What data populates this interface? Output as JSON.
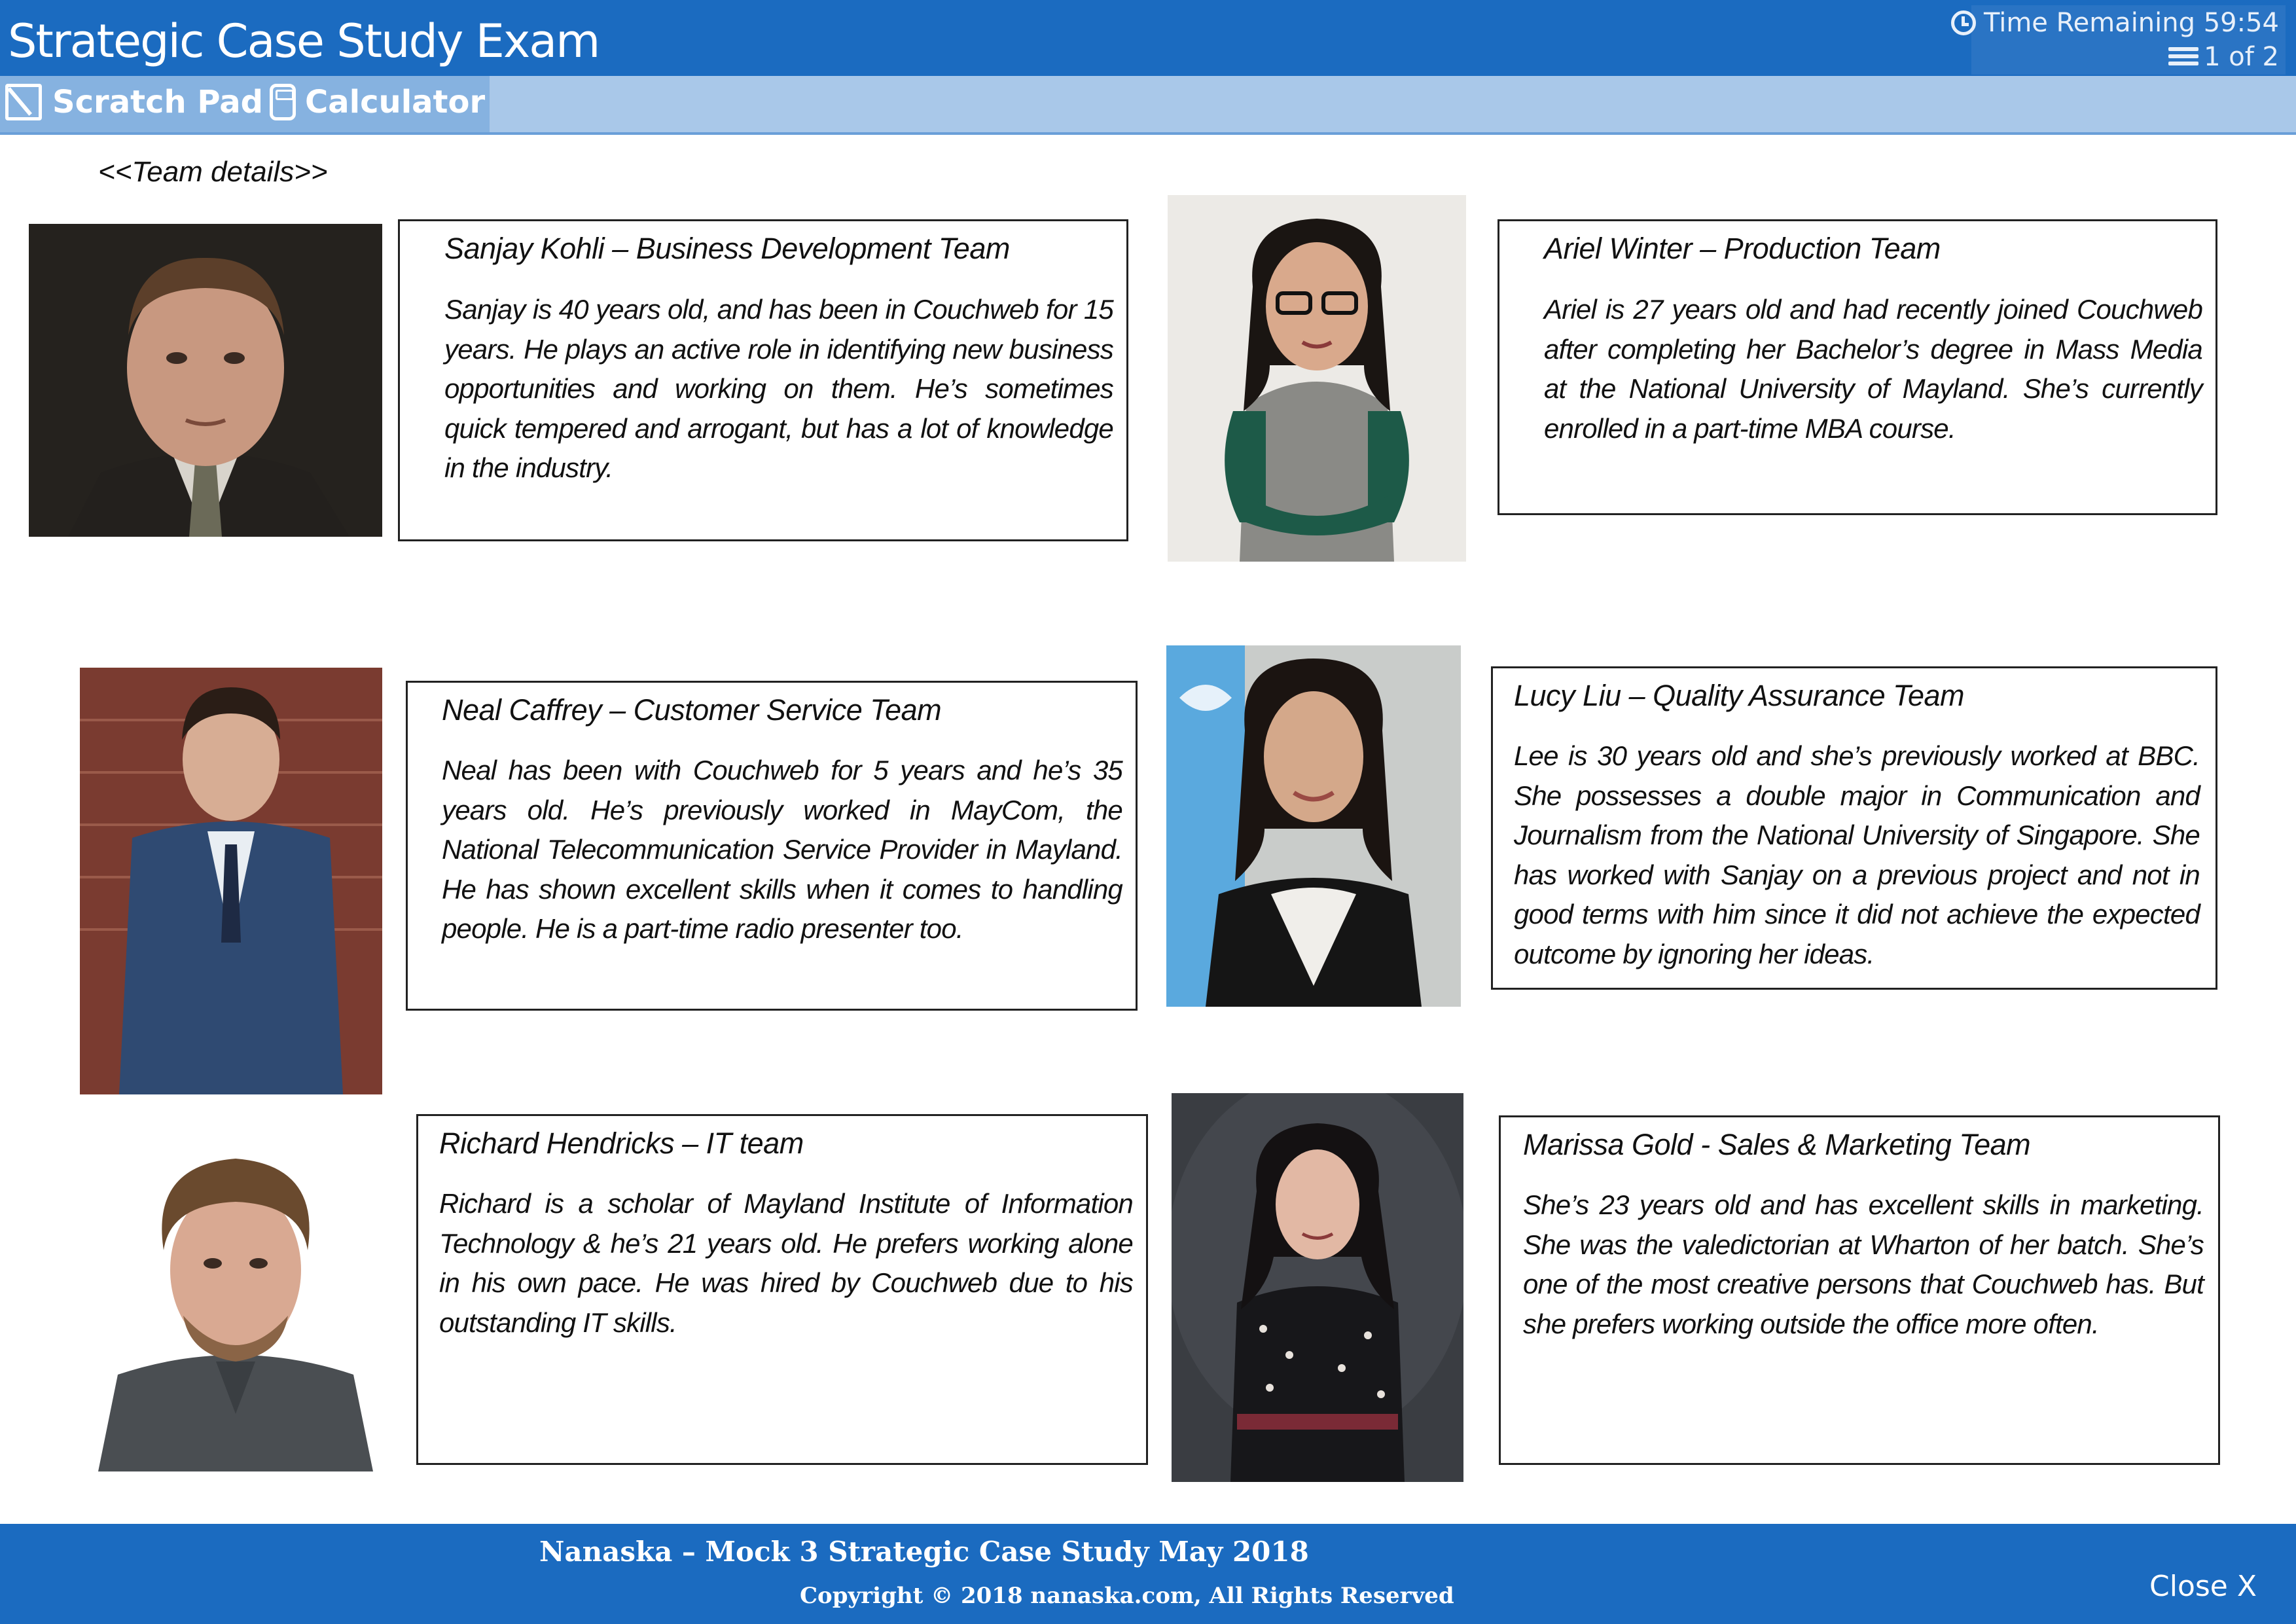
{
  "header": {
    "title": "Strategic Case Study Exam",
    "timer_label": "Time Remaining 59:54",
    "page_indicator": "1 of 2"
  },
  "toolbar": {
    "scratch_pad": "Scratch Pad",
    "calculator": "Calculator"
  },
  "section_label": "<<Team details>>",
  "team": [
    {
      "name_line": "Sanjay Kohli – Business Development Team",
      "bio": "Sanjay is 40 years old, and has been in Couchweb for 15 years. He plays an active role in identifying new business opportunities and working on them. He’s sometimes quick tempered and arrogant, but has a lot of knowledge in the industry."
    },
    {
      "name_line": "Ariel Winter – Production Team",
      "bio": "Ariel is 27 years old and had recently joined Couchweb after completing her Bachelor’s degree in Mass Media at the National University of Mayland. She’s currently enrolled in a part-time MBA course."
    },
    {
      "name_line": "Neal Caffrey – Customer Service Team",
      "bio": "Neal has been with Couchweb for 5 years and he’s 35 years old. He’s previously worked in MayCom, the National Telecommunication Service Provider in Mayland. He has shown excellent skills when it comes to handling people. He is a part-time radio presenter too."
    },
    {
      "name_line": "Lucy Liu – Quality Assurance Team",
      "bio": "Lee is 30 years old and she’s previously worked at BBC. She possesses a double major in Communication and Journalism from the National University of Singapore. She has worked with Sanjay on a previous project and not in good terms with him since it did not achieve the expected outcome by ignoring her ideas."
    },
    {
      "name_line": "Richard Hendricks – IT team",
      "bio": "Richard is a scholar of Mayland Institute of Information Technology & he’s 21 years old. He prefers working alone in his own pace. He was hired by Couchweb due to his outstanding IT skills."
    },
    {
      "name_line": "Marissa Gold - Sales & Marketing Team",
      "bio": "She’s 23 years old and has excellent skills in marketing. She was the valedictorian at Wharton of her batch. She’s one of the most creative persons that Couchweb has. But she prefers working outside the office more often."
    }
  ],
  "footer": {
    "line1": "Nanaska – Mock 3 Strategic Case Study May 2018",
    "line2": "Copyright © 2018 nanaska.com, All Rights Reserved",
    "close": "Close X"
  },
  "colors": {
    "header_blue": "#1b6bc0",
    "toolbar_light_blue": "#a9c8e9",
    "toolbar_tools_blue": "#86b2e0"
  }
}
